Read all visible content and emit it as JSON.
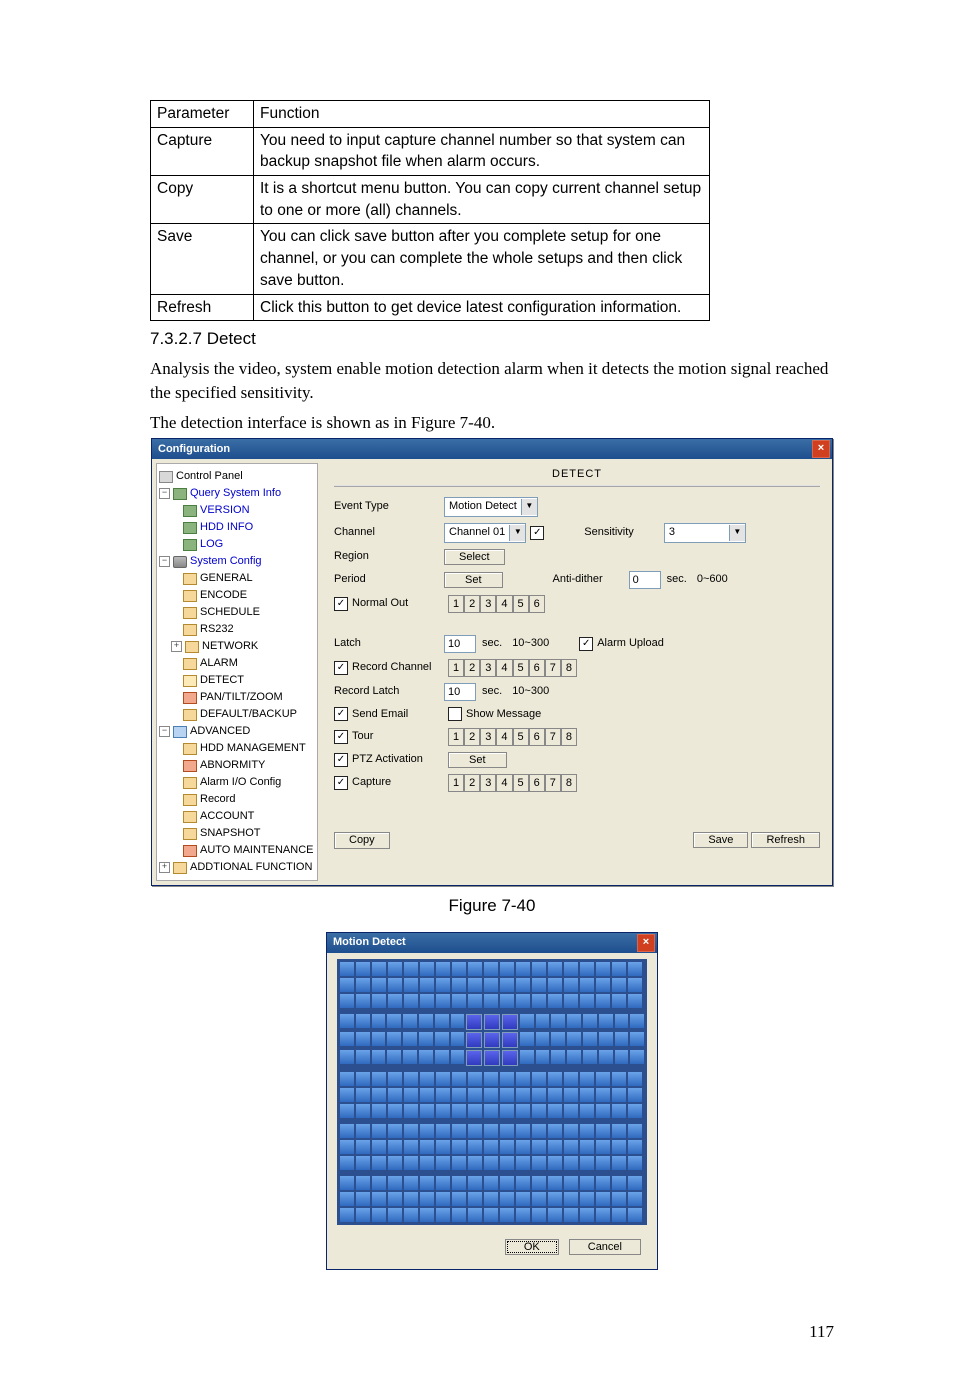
{
  "page_number": "117",
  "table": {
    "header": {
      "c0": "Parameter",
      "c1": "Function"
    },
    "rows": [
      {
        "c0": "Capture",
        "c1": "You need to input capture channel number so that system can backup snapshot file when alarm occurs."
      },
      {
        "c0": "Copy",
        "c1": "It is a shortcut menu button. You can copy current channel setup to one or more (all) channels."
      },
      {
        "c0": "Save",
        "c1": "You can click save button after you complete setup for one channel, or you can complete the whole setups and then click save button."
      },
      {
        "c0": "Refresh",
        "c1": "Click this button to get device latest configuration information."
      }
    ]
  },
  "section_heading": "7.3.2.7  Detect",
  "para1": "Analysis the video, system enable motion detection alarm when it detects the motion signal reached the specified sensitivity.",
  "para2": "The detection interface is shown as in Figure 7-40.",
  "figure_caption": "Figure 7-40",
  "config_window": {
    "title": "Configuration",
    "tree": {
      "root": "Control Panel",
      "g0": "Query System Info",
      "g0a": "VERSION",
      "g0b": "HDD INFO",
      "g0c": "LOG",
      "g1": "System Config",
      "g1a": "GENERAL",
      "g1b": "ENCODE",
      "g1c": "SCHEDULE",
      "g1d": "RS232",
      "g1e": "NETWORK",
      "g1f": "ALARM",
      "g1g": "DETECT",
      "g1h": "PAN/TILT/ZOOM",
      "g1i": "DEFAULT/BACKUP",
      "g2": "ADVANCED",
      "g2a": "HDD MANAGEMENT",
      "g2b": "ABNORMITY",
      "g2c": "Alarm I/O Config",
      "g2d": "Record",
      "g2e": "ACCOUNT",
      "g2f": "SNAPSHOT",
      "g2g": "AUTO MAINTENANCE",
      "g3": "ADDTIONAL FUNCTION"
    },
    "panel": {
      "title": "DETECT",
      "event_type_label": "Event Type",
      "event_type_value": "Motion Detect",
      "channel_label": "Channel",
      "channel_value": "Channel 01",
      "sensitivity_label": "Sensitivity",
      "sensitivity_value": "3",
      "region_label": "Region",
      "region_btn": "Select",
      "period_label": "Period",
      "period_btn": "Set",
      "antidither_label": "Anti-dither",
      "antidither_value": "0",
      "sec": "sec.",
      "antidither_range": "0~600",
      "normal_out_label": "Normal Out",
      "normal_out_buttons": [
        "1",
        "2",
        "3",
        "4",
        "5",
        "6"
      ],
      "latch_label": "Latch",
      "latch_value": "10",
      "latch_range": "10~300",
      "alarm_upload_label": "Alarm Upload",
      "record_channel_label": "Record Channel",
      "rec_buttons": [
        "1",
        "2",
        "3",
        "4",
        "5",
        "6",
        "7",
        "8"
      ],
      "record_latch_label": "Record Latch",
      "record_latch_value": "10",
      "record_latch_range": "10~300",
      "send_email_label": "Send Email",
      "show_message_label": "Show Message",
      "tour_label": "Tour",
      "tour_buttons": [
        "1",
        "2",
        "3",
        "4",
        "5",
        "6",
        "7",
        "8"
      ],
      "ptz_label": "PTZ Activation",
      "ptz_btn": "Set",
      "capture_label": "Capture",
      "capture_buttons": [
        "1",
        "2",
        "3",
        "4",
        "5",
        "6",
        "7",
        "8"
      ],
      "copy_btn": "Copy",
      "save_btn": "Save",
      "refresh_btn": "Refresh"
    }
  },
  "motion_window": {
    "title": "Motion Detect",
    "ok": "OK",
    "cancel": "Cancel"
  }
}
